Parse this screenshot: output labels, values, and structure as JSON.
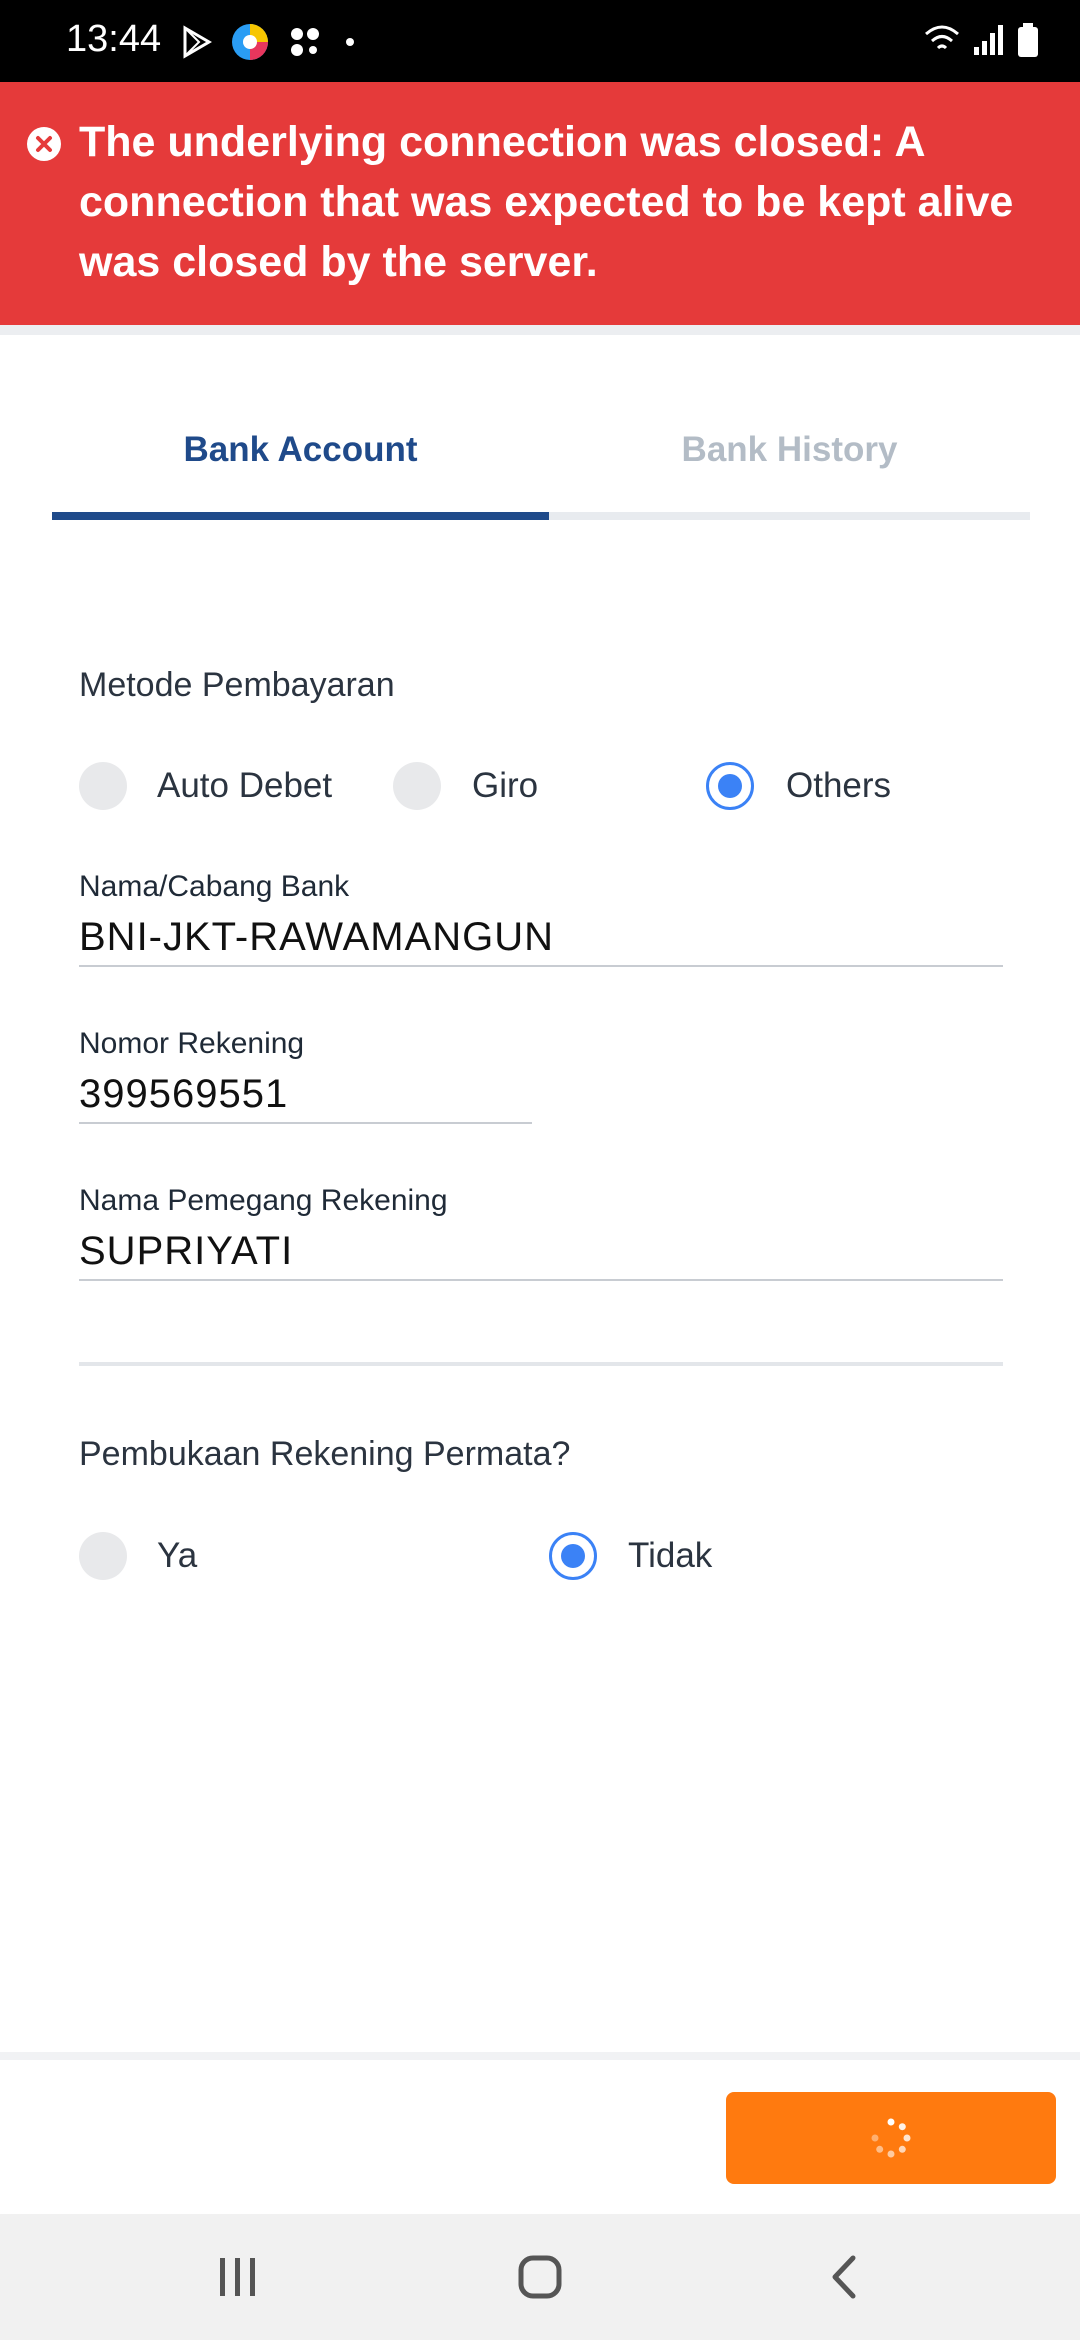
{
  "status_bar": {
    "time": "13:44",
    "left_icons": [
      "play-store-icon",
      "app-icon",
      "dots-grid-icon",
      "dot-icon"
    ],
    "right_icons": [
      "wifi-icon",
      "signal-icon",
      "battery-icon"
    ]
  },
  "error_banner": {
    "icon": "close-circle-icon",
    "message": "The underlying connection was closed: A connection that was expected to be kept alive was closed by the server.",
    "color": "#e53a3a"
  },
  "tabs": [
    {
      "label": "Bank Account",
      "active": true
    },
    {
      "label": "Bank History",
      "active": false
    }
  ],
  "payment_method": {
    "label": "Metode Pembayaran",
    "options": [
      "Auto Debet",
      "Giro",
      "Others"
    ],
    "selected": "Others"
  },
  "fields": {
    "bank_branch": {
      "label": "Nama/Cabang Bank",
      "value": "BNI-JKT-RAWAMANGUN"
    },
    "account_number": {
      "label": "Nomor Rekening",
      "value": "399569551"
    },
    "account_holder": {
      "label": "Nama Pemegang Rekening",
      "value": "SUPRIYATI"
    }
  },
  "permata": {
    "label": "Pembukaan Rekening Permata?",
    "options": [
      "Ya",
      "Tidak"
    ],
    "selected": "Tidak"
  },
  "submit_button": {
    "state": "loading",
    "color": "#ff7a0f"
  },
  "colors": {
    "accent": "#1f4a8a",
    "radio": "#3b82f6"
  },
  "nav_bar": [
    "recents-icon",
    "home-icon",
    "back-icon"
  ]
}
